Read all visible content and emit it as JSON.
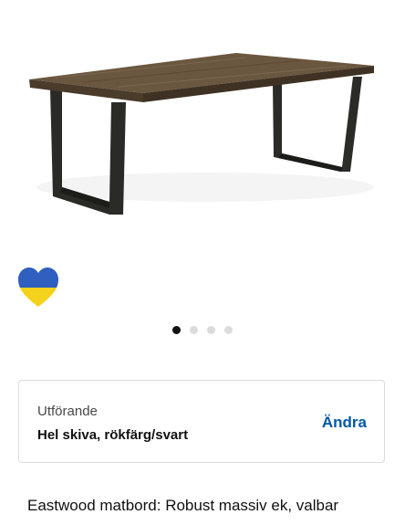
{
  "gallery": {
    "dots": [
      true,
      false,
      false,
      false
    ],
    "badge_icon": "ukraine-heart-icon",
    "badge_colors": {
      "top": "#2f5fbf",
      "bottom": "#f5d21b"
    }
  },
  "variant": {
    "label": "Utförande",
    "value": "Hel skiva, rökfärg/svart",
    "change_label": "Ändra",
    "accent_color": "#0058a3"
  },
  "description": {
    "text": "Eastwood matbord: Robust massiv ek, valbar"
  }
}
